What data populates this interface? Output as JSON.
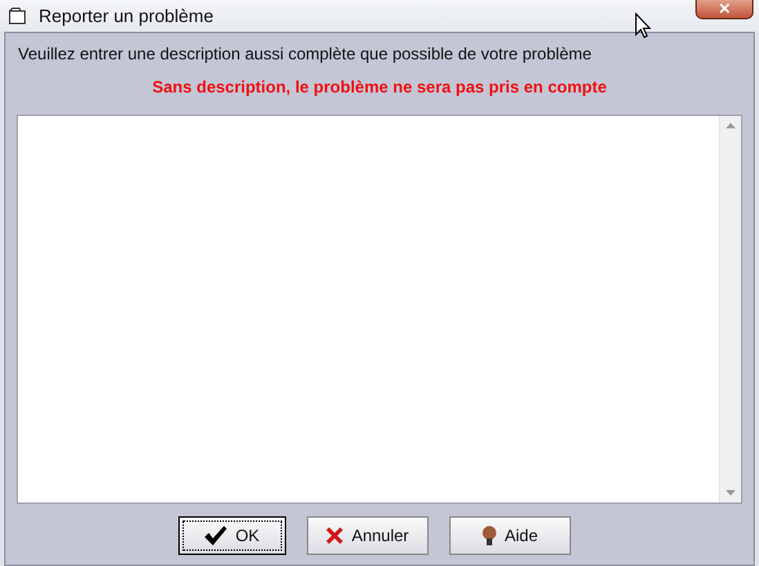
{
  "window": {
    "title": "Reporter un problème",
    "close": "✕"
  },
  "instruction": "Veuillez entrer une description aussi complète que possible de votre problème",
  "warning": "Sans description, le problème ne sera pas pris en compte",
  "buttons": [
    {
      "kind": "ok",
      "label": "OK",
      "focused": true
    },
    {
      "kind": "cancel",
      "label": "Annuler",
      "focused": false
    },
    {
      "kind": "help",
      "label": "Aide",
      "focused": false
    }
  ]
}
